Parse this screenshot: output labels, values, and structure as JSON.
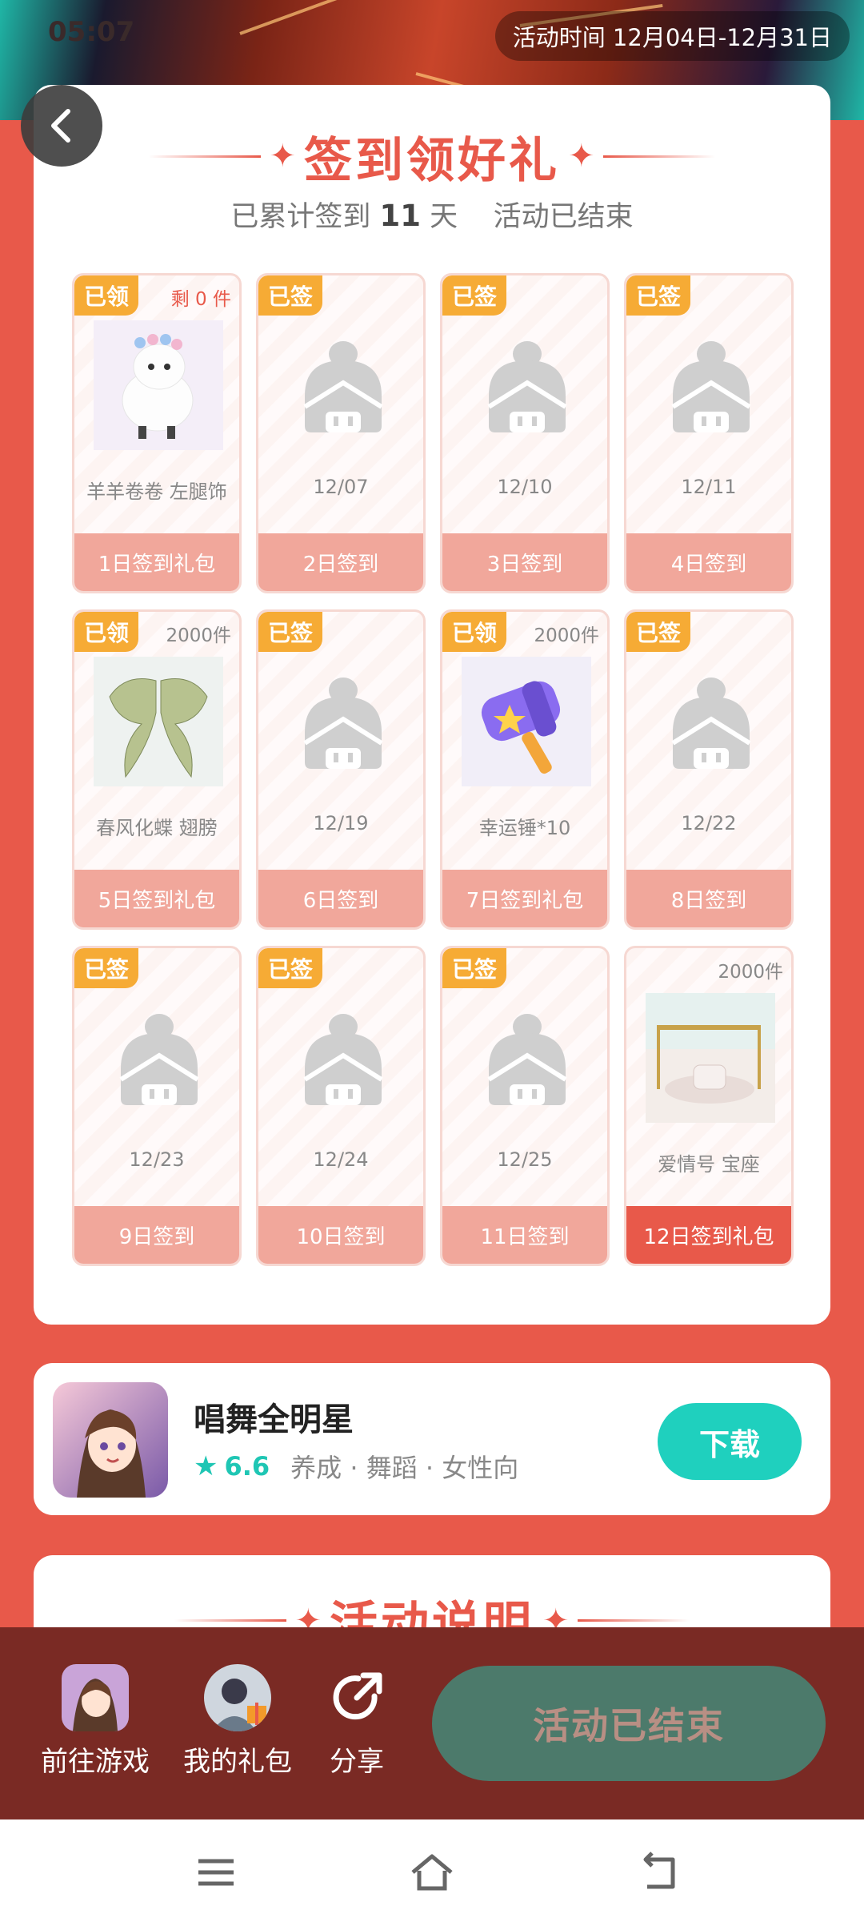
{
  "status": {
    "time": "05:07"
  },
  "header": {
    "activity_time": "活动时间 12月04日-12月31日"
  },
  "signin": {
    "title": "签到领好礼",
    "subtitle_prefix": "已累计签到",
    "subtitle_days": "11",
    "subtitle_unit": "天",
    "subtitle_status": "活动已结束",
    "cells": [
      {
        "tag": "已领",
        "remain": "剩 0 件",
        "name": "羊羊卷卷 左腿饰",
        "label": "1日签到礼包",
        "image": "alpaca-icon"
      },
      {
        "tag": "已签",
        "remain": "",
        "name": "12/07",
        "label": "2日签到",
        "image": ""
      },
      {
        "tag": "已签",
        "remain": "",
        "name": "12/10",
        "label": "3日签到",
        "image": ""
      },
      {
        "tag": "已签",
        "remain": "",
        "name": "12/11",
        "label": "4日签到",
        "image": ""
      },
      {
        "tag": "已领",
        "remain": "2000件",
        "name": "春风化蝶 翅膀",
        "label": "5日签到礼包",
        "image": "butterfly-wings-icon"
      },
      {
        "tag": "已签",
        "remain": "",
        "name": "12/19",
        "label": "6日签到",
        "image": ""
      },
      {
        "tag": "已领",
        "remain": "2000件",
        "name": "幸运锤*10",
        "label": "7日签到礼包",
        "image": "hammer-icon"
      },
      {
        "tag": "已签",
        "remain": "",
        "name": "12/22",
        "label": "8日签到",
        "image": ""
      },
      {
        "tag": "已签",
        "remain": "",
        "name": "12/23",
        "label": "9日签到",
        "image": ""
      },
      {
        "tag": "已签",
        "remain": "",
        "name": "12/24",
        "label": "10日签到",
        "image": ""
      },
      {
        "tag": "已签",
        "remain": "",
        "name": "12/25",
        "label": "11日签到",
        "image": ""
      },
      {
        "tag": "",
        "remain": "2000件",
        "name": "爱情号 宝座",
        "label": "12日签到礼包",
        "image": "throne-icon"
      }
    ]
  },
  "game": {
    "name": "唱舞全明星",
    "score": "6.6",
    "tags": "养成 · 舞蹈 · 女性向",
    "download_label": "下载"
  },
  "rules": {
    "title": "活动说明"
  },
  "bottom_bar": {
    "go_game": "前往游戏",
    "my_gifts": "我的礼包",
    "share": "分享",
    "ended": "活动已结束"
  },
  "colors": {
    "primary": "#e8594a",
    "tag": "#f6ab35",
    "accent": "#1fd0be",
    "ended_btn": "#4c7a6b"
  }
}
